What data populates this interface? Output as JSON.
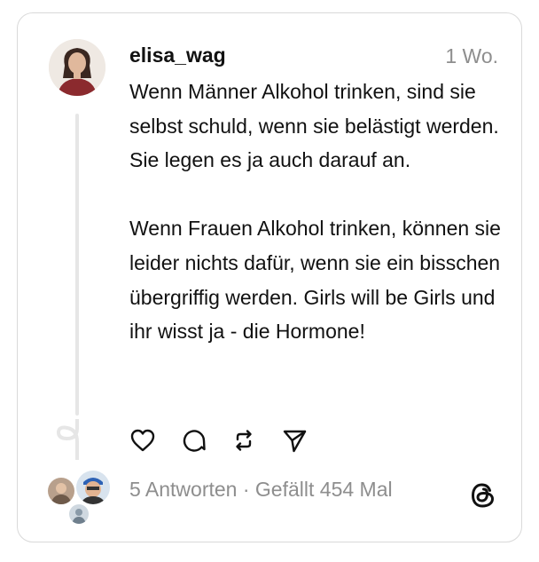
{
  "post": {
    "username": "elisa_wag",
    "time": "1 Wo.",
    "paragraphs": [
      "Wenn Männer Alkohol trinken, sind sie selbst schuld, wenn sie belästigt werden. Sie legen es ja auch darauf an.",
      "Wenn Frauen Alkohol trinken, können sie leider nichts dafür, wenn sie ein bisschen übergriffig werden. Girls will be Girls und ihr wisst ja - die Hormone!"
    ]
  },
  "actions": {
    "like_icon": "heart-icon",
    "reply_icon": "comment-icon",
    "repost_icon": "repost-icon",
    "share_icon": "send-icon"
  },
  "footer": {
    "replies": "5 Antworten",
    "separator": " · ",
    "likes": "Gefällt 454 Mal",
    "logo_icon": "threads-logo-icon"
  },
  "colors": {
    "text": "#111111",
    "muted": "#8e8e8e",
    "border": "#d9d9d9",
    "thread_line": "#e6e6e6"
  }
}
